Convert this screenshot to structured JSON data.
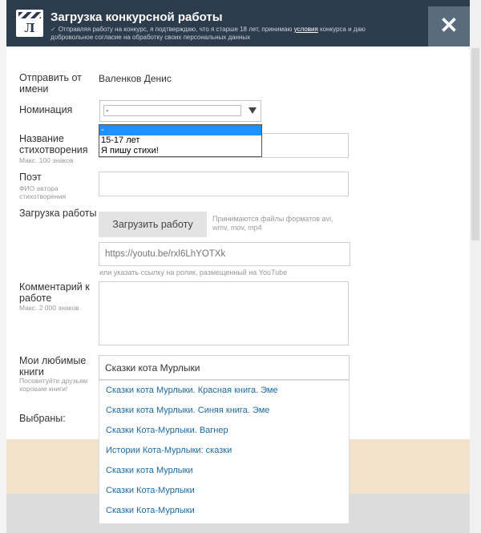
{
  "modal": {
    "title": "Загрузка конкурсной работы",
    "consent_before": "Отправляя работу на конкурс, я подтверждаю, что я старше 18 лет, принимаю ",
    "consent_link": "условия",
    "consent_after": " конкурса и даю добровольное согласие на обработку своих персональных данных",
    "close": "✕"
  },
  "form": {
    "sender": {
      "label": "Отправить от имени",
      "value": "Валенков Денис"
    },
    "nomination": {
      "label": "Номинация",
      "selected": "-",
      "options": [
        "-",
        "15-17 лет",
        "Я пишу стихи!"
      ]
    },
    "poem_title": {
      "label": "Название стихотворения",
      "hint": "Макс. 100 знаков"
    },
    "poet": {
      "label": "Поэт",
      "hint": "ФИО автора стихотворения"
    },
    "upload": {
      "label": "Загрузка работы",
      "button": "Загрузить работу",
      "formats": "Принимаются файлы форматов avi, wmv, mov, mp4",
      "url_placeholder": "https://youtu.be/rxl6LhYOTXk",
      "url_hint": "или указать ссылку на ролик, размещенный на YouTube"
    },
    "comment": {
      "label": "Комментарий к работе",
      "hint": "Макс. 2 000 знаков"
    },
    "books": {
      "label": "Мои любимые книги",
      "hint": "Посоветуйте друзьям хорошие книги!",
      "value": "Сказки кота Мурлыки",
      "suggestions": [
        "Сказки кота Мурлыки. Красная книга. Эме",
        "Сказки кота Мурлыки. Синяя книга. Эме",
        "Сказки Кота-Мурлыки. Вагнер",
        "Истории Кота-Мурлыки: сказки",
        "Сказки кота Мурлыки",
        "Сказки Кота-Мурлыки",
        "Сказки Кота-Мурлыки"
      ]
    },
    "selected": {
      "label": "Выбраны:"
    }
  },
  "colors": {
    "header": "#2d3c4d",
    "close": "#5a6b7e",
    "link": "#1a6aa8",
    "highlight": "#1e90ff",
    "footer": "#f2e2cc"
  }
}
